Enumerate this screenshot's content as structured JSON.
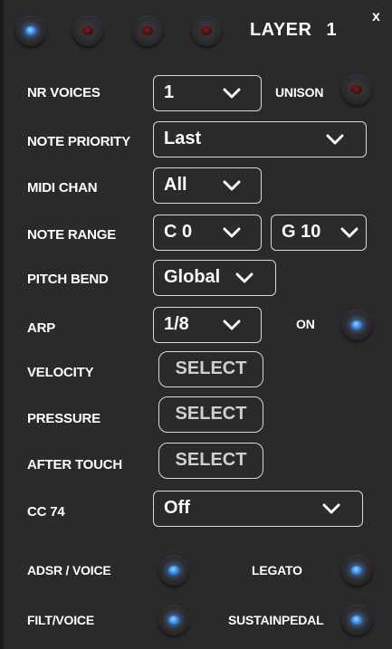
{
  "header": {
    "title": "LAYER",
    "layer_number": "1",
    "close_label": "x",
    "layer_leds": [
      {
        "state": "on"
      },
      {
        "state": "off"
      },
      {
        "state": "off"
      },
      {
        "state": "off"
      }
    ]
  },
  "rows": {
    "nr_voices": {
      "label": "NR VOICES",
      "value": "1"
    },
    "unison": {
      "label": "UNISON",
      "state": "off"
    },
    "note_priority": {
      "label": "NOTE PRIORITY",
      "value": "Last"
    },
    "midi_chan": {
      "label": "MIDI CHAN",
      "value": "All"
    },
    "note_range": {
      "label": "NOTE RANGE",
      "low": "C 0",
      "high": "G 10"
    },
    "pitch_bend": {
      "label": "PITCH BEND",
      "value": "Global"
    },
    "arp": {
      "label": "ARP",
      "value": "1/8",
      "on_label": "ON",
      "state": "on"
    },
    "velocity": {
      "label": "VELOCITY",
      "button": "SELECT"
    },
    "pressure": {
      "label": "PRESSURE",
      "button": "SELECT"
    },
    "after_touch": {
      "label": "AFTER TOUCH",
      "button": "SELECT"
    },
    "cc74": {
      "label": "CC 74",
      "value": "Off"
    },
    "adsr_voice": {
      "label": "ADSR / VOICE",
      "state": "on"
    },
    "legato": {
      "label": "LEGATO",
      "state": "on"
    },
    "filt_voice": {
      "label": "FILT/VOICE",
      "state": "on"
    },
    "sustainpedal": {
      "label": "SUSTAINPEDAL",
      "state": "on"
    }
  },
  "colors": {
    "background": "#2a2a2c",
    "led_on": "#3b8fe8",
    "led_off": "#4a0d0d",
    "border": "#d8d8d8"
  }
}
